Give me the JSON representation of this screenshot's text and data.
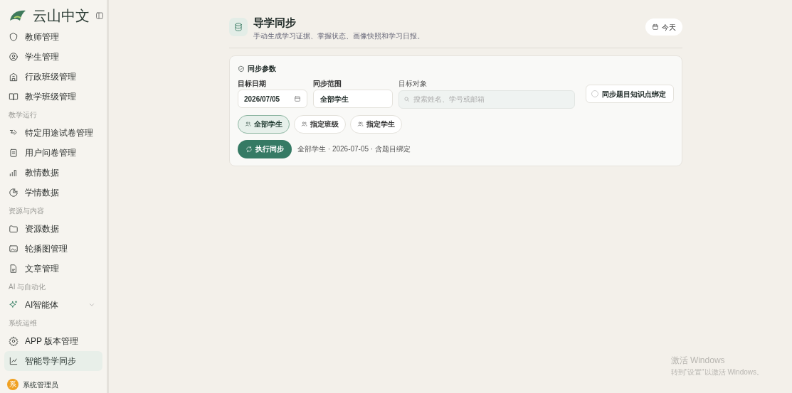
{
  "sidebar": {
    "brand": "云山中文",
    "groups": [
      {
        "items": [
          {
            "label": "教师管理",
            "selected": false
          },
          {
            "label": "学生管理",
            "selected": false
          },
          {
            "label": "行政班级管理",
            "selected": false
          },
          {
            "label": "教学班级管理",
            "selected": false
          }
        ]
      },
      {
        "label": "教学运行",
        "items": [
          {
            "label": "特定用途试卷管理",
            "selected": false
          },
          {
            "label": "用户问卷管理",
            "selected": false
          },
          {
            "label": "教情数据",
            "selected": false
          },
          {
            "label": "学情数据",
            "selected": false
          }
        ]
      },
      {
        "label": "资源与内容",
        "items": [
          {
            "label": "资源数据",
            "selected": false
          },
          {
            "label": "轮播图管理",
            "selected": false
          },
          {
            "label": "文章管理",
            "selected": false
          }
        ]
      },
      {
        "label": "AI 与自动化",
        "items": [
          {
            "label": "AI智能体",
            "selected": false,
            "expandable": true
          }
        ]
      },
      {
        "label": "系统运维",
        "items": [
          {
            "label": "APP 版本管理",
            "selected": false
          },
          {
            "label": "智能导学同步",
            "selected": true
          }
        ]
      }
    ],
    "user": {
      "avatar": "系",
      "name": "系统管理员"
    }
  },
  "header": {
    "title": "导学同步",
    "subtitle": "手动生成学习证据、掌握状态、画像快照和学习日报。",
    "today_button": "今天"
  },
  "card": {
    "title": "同步参数",
    "fields": [
      {
        "label": "目标日期",
        "value": "2026/07/05"
      },
      {
        "label": "同步范围",
        "value": "全部学生"
      },
      {
        "label": "目标对象",
        "placeholder": "搜索姓名、学号或邮箱"
      }
    ],
    "option": {
      "label": "同步题目知识点绑定",
      "checked": false
    },
    "scopes": [
      {
        "label": "全部学生",
        "selected": true
      },
      {
        "label": "指定班级",
        "selected": false
      },
      {
        "label": "指定学生",
        "selected": false
      }
    ],
    "run_button": "执行同步",
    "summary": "全部学生 · 2026-07-05 · 含题目绑定"
  },
  "os_notice": {
    "title": "激活 Windows",
    "text": "转到\"设置\"以激活 Windows。"
  }
}
